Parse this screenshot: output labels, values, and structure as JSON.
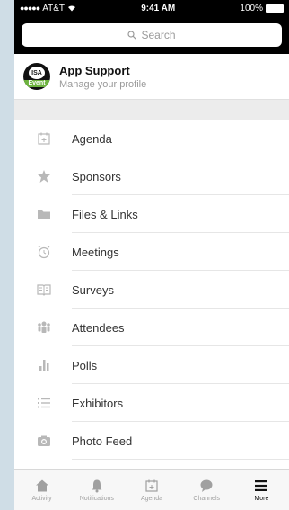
{
  "status": {
    "carrier": "AT&T",
    "time": "9:41 AM",
    "battery": "100%"
  },
  "search": {
    "placeholder": "Search"
  },
  "profile": {
    "title": "App Support",
    "subtitle": "Manage your profile",
    "logo_text": "ISA",
    "logo_band": "Event"
  },
  "menu": [
    {
      "label": "Agenda",
      "icon": "calendar-icon"
    },
    {
      "label": "Sponsors",
      "icon": "star-icon"
    },
    {
      "label": "Files & Links",
      "icon": "folder-icon"
    },
    {
      "label": "Meetings",
      "icon": "alarm-clock-icon"
    },
    {
      "label": "Surveys",
      "icon": "book-icon"
    },
    {
      "label": "Attendees",
      "icon": "people-icon"
    },
    {
      "label": "Polls",
      "icon": "bar-chart-icon"
    },
    {
      "label": "Exhibitors",
      "icon": "list-icon"
    },
    {
      "label": "Photo Feed",
      "icon": "camera-icon"
    }
  ],
  "tabs": [
    {
      "label": "Activity",
      "icon": "home-icon"
    },
    {
      "label": "Notifications",
      "icon": "bell-icon"
    },
    {
      "label": "Agenda",
      "icon": "calendar-icon"
    },
    {
      "label": "Channels",
      "icon": "chat-bubble-icon"
    },
    {
      "label": "More",
      "icon": "hamburger-menu-icon"
    }
  ],
  "colors": {
    "bg": "#cfdde6",
    "accent_green": "#6db33f",
    "icon_gray": "#b8b8b8"
  }
}
